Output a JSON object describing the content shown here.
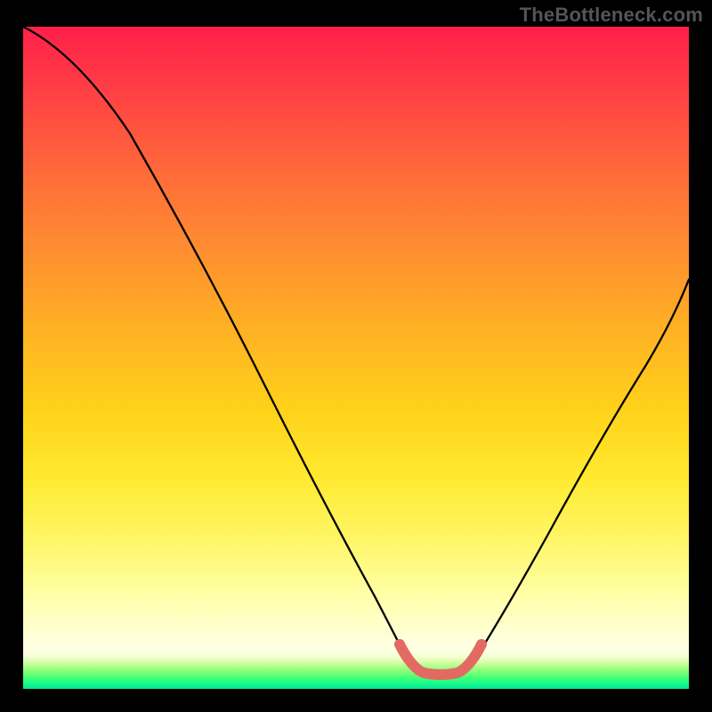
{
  "watermark": {
    "text": "TheBottleneck.com"
  },
  "colors": {
    "frame_bg": "#000000",
    "watermark_text": "#555555",
    "curve": "#000000",
    "bottom_accent": "#e36a63",
    "gradient_stops": [
      "#ff1f4a",
      "#ff3a46",
      "#ff6a3a",
      "#ff8f30",
      "#ffb223",
      "#ffd21a",
      "#ffe92f",
      "#fff76a",
      "#ffffa8",
      "#ffffd0",
      "#ffffe6",
      "#f4ffcf",
      "#c9ff9a",
      "#8cff7a",
      "#4dff73",
      "#1dff84",
      "#00e79a"
    ]
  },
  "chart_data": {
    "type": "line",
    "title": "",
    "xlabel": "",
    "ylabel": "",
    "xlim": [
      0,
      100
    ],
    "ylim": [
      0,
      100
    ],
    "notes": "Bottleneck-style V curve. Two sides dip to a near-zero valley around x≈59–66; accent highlights the valley floor. No numeric axis labels are visible — values are visual estimates in relative 0–100 plot coordinates (0,0 = bottom-left of colored area).",
    "series": [
      {
        "name": "left-branch",
        "x": [
          0,
          5.7,
          12,
          18,
          24,
          30,
          36,
          42,
          48,
          53,
          56.5,
          58.5
        ],
        "y": [
          100,
          98,
          90,
          81,
          71,
          60,
          49,
          37.5,
          25.5,
          14.5,
          7,
          3.2
        ]
      },
      {
        "name": "right-branch",
        "x": [
          67,
          70,
          74,
          78,
          82,
          86,
          90,
          94,
          98,
          100
        ],
        "y": [
          3.2,
          7,
          13,
          20,
          27,
          35,
          42.5,
          50.5,
          58.5,
          62
        ]
      },
      {
        "name": "valley-accent",
        "x": [
          56.5,
          58.5,
          60.5,
          62.8,
          65,
          67
        ],
        "y": [
          7,
          3.2,
          2.3,
          2.3,
          3.2,
          7
        ]
      }
    ]
  }
}
